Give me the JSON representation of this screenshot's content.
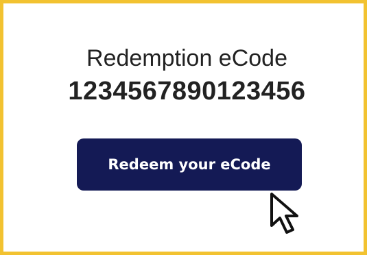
{
  "ecode": {
    "label": "Redemption eCode",
    "value": "1234567890123456"
  },
  "redeem_button": {
    "label": "Redeem your eCode"
  },
  "colors": {
    "frame_border": "#f2c230",
    "button_background": "#141a55",
    "button_text": "#ffffff",
    "text": "#222222"
  },
  "icons": {
    "pointer": "mouse-pointer-icon"
  }
}
